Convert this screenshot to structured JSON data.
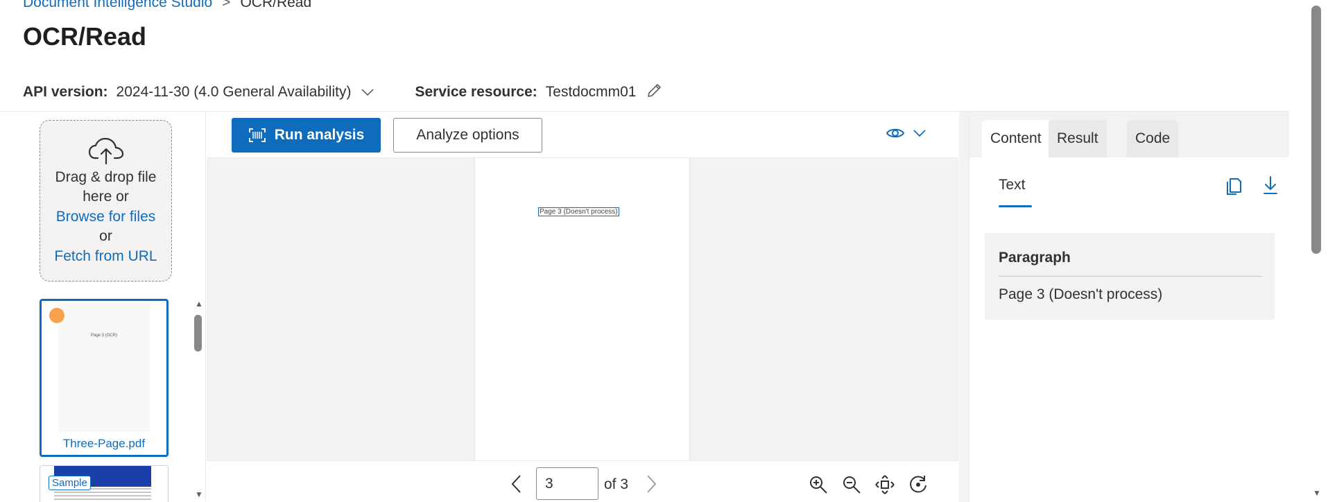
{
  "breadcrumb": {
    "root": "Document Intelligence Studio",
    "separator": ">",
    "current": "OCR/Read"
  },
  "page_title": "OCR/Read",
  "api": {
    "label": "API version:",
    "value": "2024-11-30 (4.0 General Availability)"
  },
  "service": {
    "label": "Service resource:",
    "value": "Testdocmm01"
  },
  "dropzone": {
    "line1": "Drag & drop file",
    "line2": "here or",
    "browse": "Browse for files",
    "or": "or",
    "fetch": "Fetch from URL"
  },
  "thumbnails": [
    {
      "name": "Three-Page.pdf",
      "mini_text": "Page 3 (OCR)"
    },
    {
      "badge": "Sample"
    }
  ],
  "toolbar": {
    "run_label": "Run analysis",
    "options_label": "Analyze options"
  },
  "document": {
    "page_text": "Page 3 (Doesn't process)"
  },
  "pager": {
    "current_page": "3",
    "of_label": "of 3"
  },
  "right_panel": {
    "tabs": [
      "Content",
      "Result",
      "Code"
    ],
    "subtab": "Text",
    "paragraph_title": "Paragraph",
    "paragraph_text": "Page 3 (Doesn't process)"
  },
  "colors": {
    "accent": "#0f6cbd",
    "badge_dot": "#f7a14a"
  }
}
